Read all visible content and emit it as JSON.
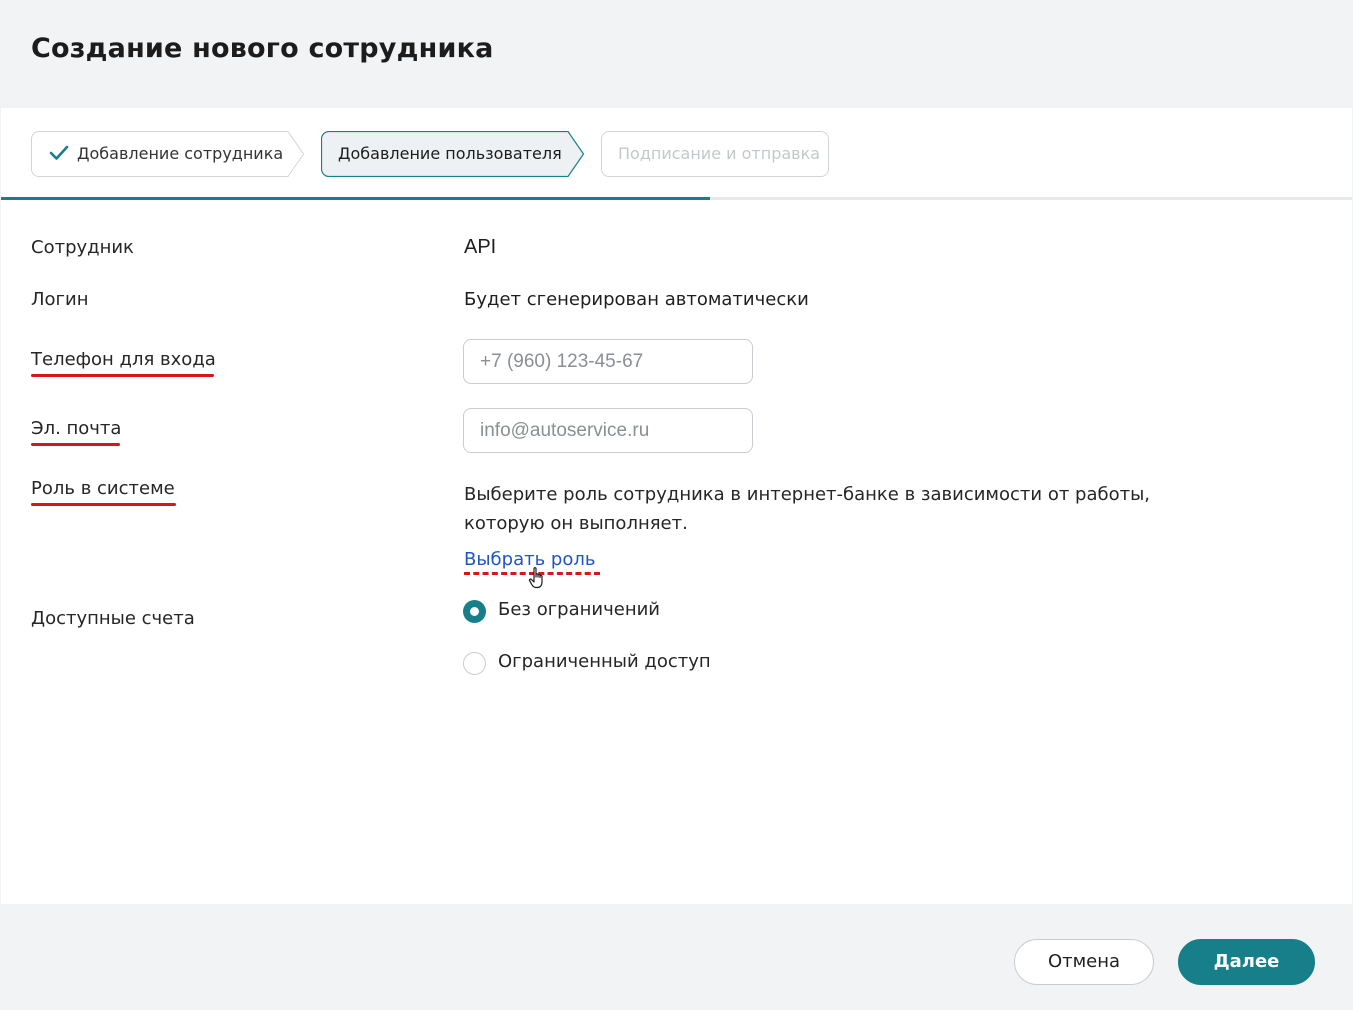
{
  "header": {
    "title": "Создание нового сотрудника"
  },
  "stepper": {
    "steps": [
      {
        "label": "Добавление сотрудника",
        "state": "done"
      },
      {
        "label": "Добавление пользователя",
        "state": "active"
      },
      {
        "label": "Подписание и отправка",
        "state": "disabled"
      }
    ],
    "progress_percent": 52.5
  },
  "form": {
    "employee": {
      "label": "Сотрудник",
      "value": "API"
    },
    "login": {
      "label": "Логин",
      "value": "Будет сгенерирован автоматически"
    },
    "phone": {
      "label": "Телефон для входа",
      "placeholder": "+7 (960) 123-45-67"
    },
    "email": {
      "label": "Эл. почта",
      "placeholder": "info@autoservice.ru"
    },
    "role": {
      "label": "Роль в системе",
      "description": "Выберите роль сотрудника в интернет-банке в зависимости от работы, которую он выполняет.",
      "link": "Выбрать роль"
    },
    "accounts": {
      "label": "Доступные счета",
      "options": [
        {
          "label": "Без ограничений",
          "selected": true
        },
        {
          "label": "Ограниченный доступ",
          "selected": false
        }
      ]
    }
  },
  "footer": {
    "cancel_label": "Отмена",
    "next_label": "Далее"
  },
  "colors": {
    "accent": "#167f8a",
    "link": "#1f55c8",
    "annotation_red": "#d8151b"
  }
}
